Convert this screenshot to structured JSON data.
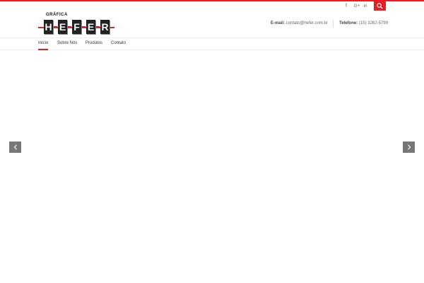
{
  "colors": {
    "accent": "#e41e26",
    "text": "#333333",
    "arrow_bg": "#777777"
  },
  "topbar": {
    "social": [
      {
        "icon": "facebook-icon",
        "glyph": "f"
      },
      {
        "icon": "google-plus-icon",
        "glyph": "G+"
      },
      {
        "icon": "linkedin-icon",
        "glyph": "in"
      }
    ],
    "search_icon": "search-icon"
  },
  "logo": {
    "top_word": "GRÁFICA",
    "letters": [
      "H",
      "E",
      "F",
      "E",
      "R"
    ]
  },
  "contact": {
    "email_label": "E-mail:",
    "email_value": "contato@hefer.com.br",
    "phone_label": "Telefone:",
    "phone_value": "(15) 3262-5799"
  },
  "nav": {
    "items": [
      {
        "label": "Início"
      },
      {
        "label": "Sobre Nós"
      },
      {
        "label": "Produtos"
      },
      {
        "label": "Contato"
      }
    ]
  },
  "slider": {
    "prev_icon": "chevron-left-icon",
    "next_icon": "chevron-right-icon"
  }
}
